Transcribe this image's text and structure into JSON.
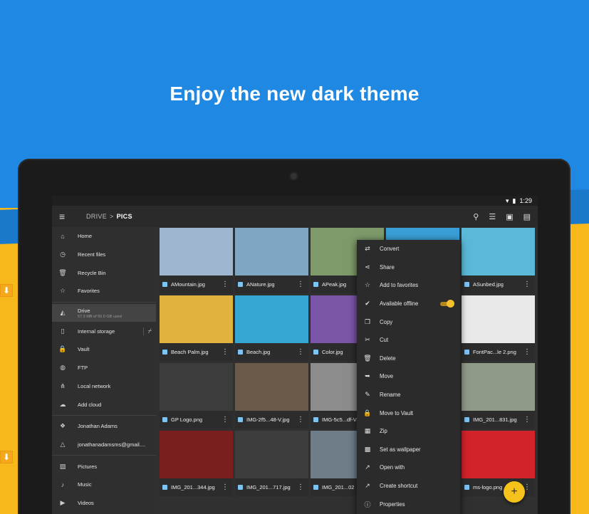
{
  "headline": "Enjoy the new dark theme",
  "status": {
    "time": "1:29"
  },
  "appbar": {
    "crumb_root": "DRIVE",
    "crumb_sep": ">",
    "crumb_current": "PICS"
  },
  "drawer": {
    "items": [
      {
        "label": "Home",
        "icon": "home-icon"
      },
      {
        "label": "Recent files",
        "icon": "clock-icon"
      },
      {
        "label": "Recycle Bin",
        "icon": "trash-icon"
      },
      {
        "label": "Favorites",
        "icon": "star-icon"
      }
    ],
    "drive": {
      "label": "Drive",
      "sub": "57.3 MB of 50.0 GB used"
    },
    "storage": [
      {
        "label": "Internal storage",
        "icon": "phone-icon"
      },
      {
        "label": "Vault",
        "icon": "lock-icon"
      },
      {
        "label": "FTP",
        "icon": "globe-icon"
      },
      {
        "label": "Local network",
        "icon": "network-icon"
      },
      {
        "label": "Add cloud",
        "icon": "cloud-add-icon"
      }
    ],
    "accounts": [
      {
        "label": "Jonathan Adams",
        "icon": "dropbox-icon"
      },
      {
        "label": "jonathanadamsms@gmail....",
        "icon": "gdrive-icon"
      }
    ],
    "media": [
      {
        "label": "Pictures",
        "icon": "image-icon"
      },
      {
        "label": "Music",
        "icon": "music-icon"
      },
      {
        "label": "Videos",
        "icon": "video-icon"
      }
    ]
  },
  "files": [
    {
      "name": "AMountain.jpg",
      "color": "#9fb6cf"
    },
    {
      "name": "ANature.jpg",
      "color": "#7fa7c4"
    },
    {
      "name": "APeak.jpg",
      "color": "#7e9a6a"
    },
    {
      "name": "",
      "color": "#3a9fd8"
    },
    {
      "name": "ASunbed.jpg",
      "color": "#5bb9d8"
    },
    {
      "name": "Beach Palm.jpg",
      "color": "#e1b23d"
    },
    {
      "name": "Beach.jpg",
      "color": "#34a7d2"
    },
    {
      "name": "Color.jpg",
      "color": "#7b55a8"
    },
    {
      "name": "",
      "color": "#444444"
    },
    {
      "name": "FontPac...le 2.png",
      "color": "#e9e9e9"
    },
    {
      "name": "GP Logo.png",
      "color": "#3c3c3c"
    },
    {
      "name": "IMG-2f5...48-V.jpg",
      "color": "#6a5a4a"
    },
    {
      "name": "IMG-5c5...df-V.jpg",
      "color": "#8c8c8c"
    },
    {
      "name": "",
      "color": "#444444"
    },
    {
      "name": "IMG_201...831.jpg",
      "color": "#8f9a88"
    },
    {
      "name": "IMG_201...344.jpg",
      "color": "#7a1e1e"
    },
    {
      "name": "IMG_201...717.jpg",
      "color": "#3d3d3d"
    },
    {
      "name": "IMG_201...02",
      "color": "#6f7d88"
    },
    {
      "name": "",
      "color": "#444444"
    },
    {
      "name": "ms-logo.png",
      "color": "#d2232a"
    }
  ],
  "context_menu": [
    {
      "label": "Convert",
      "icon": "convert-icon"
    },
    {
      "label": "Share",
      "icon": "share-icon"
    },
    {
      "label": "Add to favorites",
      "icon": "star-icon"
    },
    {
      "label": "Available offline",
      "icon": "offline-icon",
      "toggle": true
    },
    {
      "label": "Copy",
      "icon": "copy-icon"
    },
    {
      "label": "Cut",
      "icon": "scissors-icon"
    },
    {
      "label": "Delete",
      "icon": "trash-icon"
    },
    {
      "label": "Move",
      "icon": "move-icon"
    },
    {
      "label": "Rename",
      "icon": "pencil-icon"
    },
    {
      "label": "Move to Vault",
      "icon": "lock-icon"
    },
    {
      "label": "Zip",
      "icon": "zip-icon"
    },
    {
      "label": "Set as wallpaper",
      "icon": "wallpaper-icon"
    },
    {
      "label": "Open with",
      "icon": "open-with-icon"
    },
    {
      "label": "Create shortcut",
      "icon": "shortcut-icon"
    },
    {
      "label": "Properties",
      "icon": "info-icon"
    }
  ],
  "colors": {
    "blue": "#1f88e3",
    "yellow": "#f7b81b",
    "accent": "#f5c11b"
  }
}
